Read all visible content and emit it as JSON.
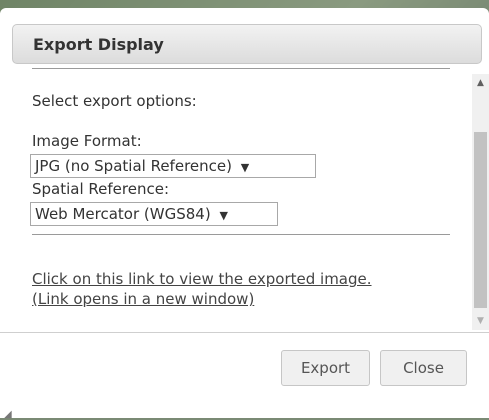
{
  "dialog": {
    "title": "Export Display"
  },
  "form": {
    "intro": "Select export options:",
    "image_format_label": "Image Format:",
    "image_format_value": "JPG (no Spatial Reference)",
    "spatial_reference_label": "Spatial Reference:",
    "spatial_reference_value": "Web Mercator (WGS84)"
  },
  "link": {
    "line1": "Click on this link to view the exported image.",
    "line2": "(Link opens in a new window)"
  },
  "buttons": {
    "export_label": "Export",
    "close_label": "Close"
  },
  "icons": {
    "dropdown": "caret-down-icon",
    "scroll_up": "triangle-up-icon",
    "scroll_down": "triangle-down-icon",
    "resize": "resize-grip-icon"
  },
  "colors": {
    "title_bar": "#dcdcdc",
    "text": "#333333",
    "button_bg": "#f0f0f0"
  }
}
